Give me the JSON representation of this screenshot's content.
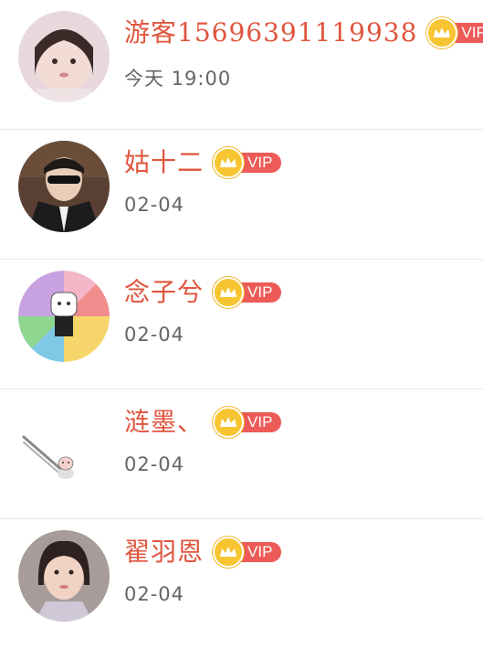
{
  "conversations": [
    {
      "name": "游客15696391119938",
      "time": "今天 19:00",
      "badge": "VIP"
    },
    {
      "name": "姑十二",
      "time": "02-04",
      "badge": "VIP"
    },
    {
      "name": "念子兮",
      "time": "02-04",
      "badge": "VIP"
    },
    {
      "name": "涟墨、",
      "time": "02-04",
      "badge": "VIP"
    },
    {
      "name": "翟羽恩",
      "time": "02-04",
      "badge": "VIP"
    }
  ],
  "colors": {
    "name": "#e0553e",
    "vip_tag": "#ec5b57",
    "crown": "#f7c531",
    "time": "#666666",
    "divider": "#e9e9e9"
  },
  "icons": {
    "badge": "crown-icon"
  }
}
